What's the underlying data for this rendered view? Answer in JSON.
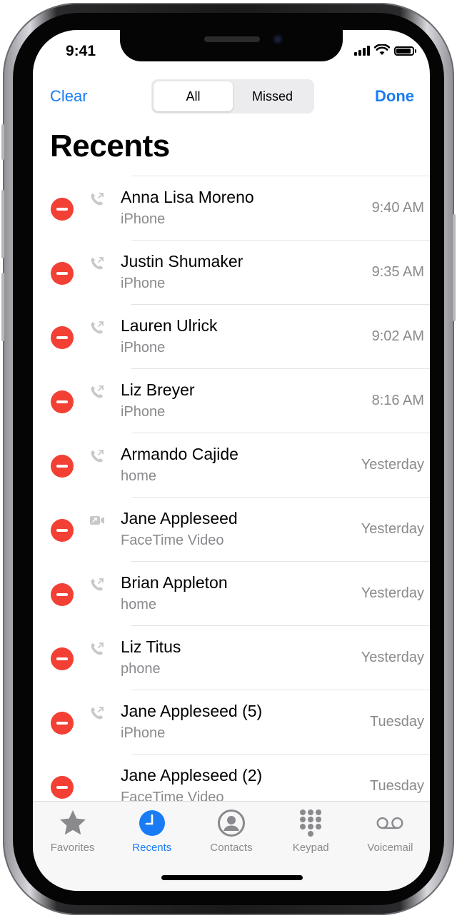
{
  "colors": {
    "accent": "#1a7cf5",
    "delete": "#f24034",
    "secondary_text": "#8a8a8e"
  },
  "status_bar": {
    "time": "9:41"
  },
  "nav": {
    "clear_label": "Clear",
    "done_label": "Done",
    "segments": [
      {
        "label": "All",
        "selected": true
      },
      {
        "label": "Missed",
        "selected": false
      }
    ]
  },
  "page_title": "Recents",
  "calls": [
    {
      "name": "Anna Lisa Moreno",
      "detail": "iPhone",
      "time": "9:40 AM",
      "icon": "outgoing-call-icon"
    },
    {
      "name": "Justin Shumaker",
      "detail": "iPhone",
      "time": "9:35 AM",
      "icon": "outgoing-call-icon"
    },
    {
      "name": "Lauren Ulrick",
      "detail": "iPhone",
      "time": "9:02 AM",
      "icon": "outgoing-call-icon"
    },
    {
      "name": "Liz Breyer",
      "detail": "iPhone",
      "time": "8:16 AM",
      "icon": "outgoing-call-icon"
    },
    {
      "name": "Armando Cajide",
      "detail": "home",
      "time": "Yesterday",
      "icon": "outgoing-call-icon"
    },
    {
      "name": "Jane Appleseed",
      "detail": "FaceTime Video",
      "time": "Yesterday",
      "icon": "facetime-video-icon"
    },
    {
      "name": "Brian Appleton",
      "detail": "home",
      "time": "Yesterday",
      "icon": "outgoing-call-icon"
    },
    {
      "name": "Liz Titus",
      "detail": "phone",
      "time": "Yesterday",
      "icon": "outgoing-call-icon"
    },
    {
      "name": "Jane Appleseed (5)",
      "detail": "iPhone",
      "time": "Tuesday",
      "icon": "outgoing-call-icon"
    },
    {
      "name": "Jane Appleseed (2)",
      "detail": "FaceTime Video",
      "time": "Tuesday",
      "icon": ""
    }
  ],
  "tabs": [
    {
      "label": "Favorites",
      "icon": "star-icon",
      "active": false
    },
    {
      "label": "Recents",
      "icon": "clock-icon",
      "active": true
    },
    {
      "label": "Contacts",
      "icon": "person-circle-icon",
      "active": false
    },
    {
      "label": "Keypad",
      "icon": "keypad-icon",
      "active": false
    },
    {
      "label": "Voicemail",
      "icon": "voicemail-icon",
      "active": false
    }
  ]
}
